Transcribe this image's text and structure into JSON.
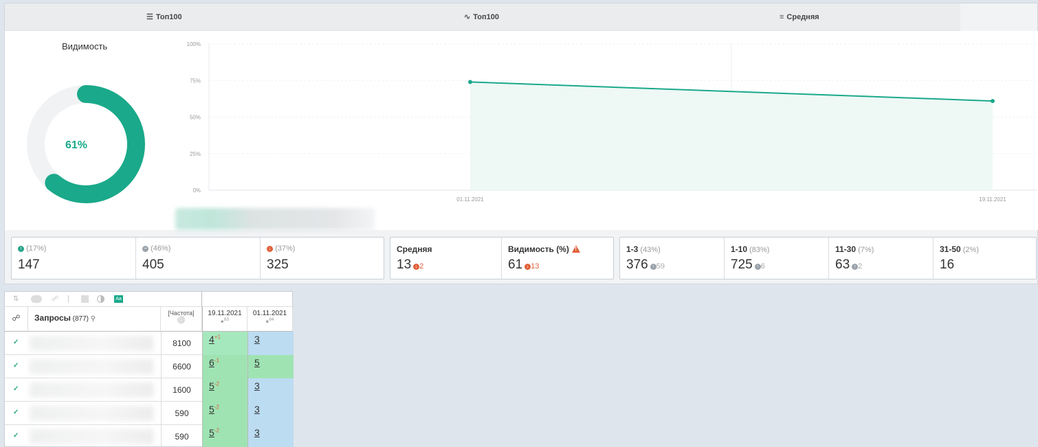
{
  "tabs": [
    {
      "label": "Топ100",
      "icon": "layers-icon"
    },
    {
      "label": "Топ100",
      "icon": "trend-icon"
    },
    {
      "label": "Средняя",
      "icon": "list-icon"
    }
  ],
  "visibility": {
    "title": "Видимость",
    "percent": "61%",
    "value": 0.61
  },
  "chart_data": {
    "type": "area",
    "x": [
      "01.11.2021",
      "19.11.2021"
    ],
    "values": [
      74,
      61
    ],
    "ylim": [
      0,
      100
    ],
    "yticks": [
      "0%",
      "25%",
      "50%",
      "75%",
      "100%"
    ],
    "xticks": [
      "01.11.2021",
      "19.11.2021"
    ],
    "color": "#1aa98a"
  },
  "stats": {
    "g1": [
      {
        "icon": "up",
        "pct": "(17%)",
        "value": "147"
      },
      {
        "icon": "neutral",
        "pct": "(46%)",
        "value": "405"
      },
      {
        "icon": "down",
        "pct": "(37%)",
        "value": "325"
      }
    ],
    "g2": [
      {
        "label": "Средняя",
        "value": "13",
        "delta": "2",
        "dir": "down"
      },
      {
        "label": "Видимость (%)",
        "value": "61",
        "delta": "13",
        "dir": "down"
      }
    ],
    "g3": [
      {
        "label": "1-3",
        "pct": "(43%)",
        "value": "376",
        "delta": "59"
      },
      {
        "label": "1-10",
        "pct": "(83%)",
        "value": "725",
        "delta": "6"
      },
      {
        "label": "11-30",
        "pct": "(7%)",
        "value": "63",
        "delta": "2"
      },
      {
        "label": "31-50",
        "pct": "(2%)",
        "value": "16",
        "delta": ""
      }
    ]
  },
  "table": {
    "queries_label": "Запросы",
    "queries_count": "(877)",
    "freq_header": "[Частота]",
    "date1": "19.11.2021",
    "date1_sub": "83",
    "date2": "01.11.2021",
    "date2_sub": "84",
    "rows": [
      {
        "freq": "8100",
        "pos1": "4",
        "d1": "+1",
        "pos2": "3"
      },
      {
        "freq": "6600",
        "pos1": "6",
        "d1": "-1",
        "pos2": "5"
      },
      {
        "freq": "1600",
        "pos1": "5",
        "d1": "-2",
        "pos2": "3"
      },
      {
        "freq": "590",
        "pos1": "5",
        "d1": "-2",
        "pos2": "3"
      },
      {
        "freq": "590",
        "pos1": "5",
        "d1": "-2",
        "pos2": "3"
      }
    ]
  }
}
